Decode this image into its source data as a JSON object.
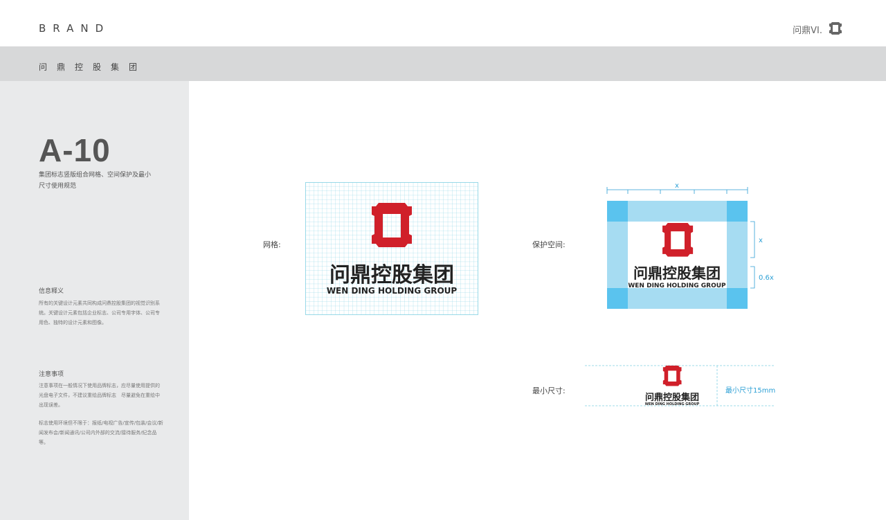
{
  "header": {
    "brand": "BRAND",
    "vi_label": "问鼎VI.",
    "vi_icon": "frame-logo-icon"
  },
  "band": {
    "title": "问鼎控股集团"
  },
  "sidebar": {
    "code": "A-10",
    "subtitle": "集团标志竖版组合网格、空间保护及最小尺寸使用规范",
    "sections": [
      {
        "heading": "信息释义",
        "body": "所有的关键设计元素共同构成问鼎控股集团的视觉识别系统。关键设计元素包括企业标志、公司专用字体、公司专用色、独特的设计元素和图像。"
      },
      {
        "heading": "注意事项",
        "body": "注意事项在一般情况下使用品牌标志，应尽量使用提供的光盘电子文件，不建议重绘品牌标志　尽量避免在重绘中出现误差。",
        "body2": "标志使用环境但不限于：报纸/电视广告/宣传/包装/会议/新闻发布会/新闻通讯/公司内外部的交流/接待服务/纪念品等。"
      }
    ]
  },
  "main": {
    "grid_label": "网格:",
    "protect_label": "保护空间:",
    "min_label": "最小尺寸:",
    "logo_cn": "问鼎控股集团",
    "logo_en": "WEN DING HOLDING GROUP",
    "dim_x": "x",
    "dim_06x": "0.6x",
    "min_size_note": "最小尺寸15mm"
  },
  "colors": {
    "logo_red": "#d0202a",
    "grid_line": "#7fd0e3",
    "protect_light": "#a6dcf2",
    "protect_dark": "#5ac3ee",
    "dim_blue": "#2b9fd5"
  }
}
